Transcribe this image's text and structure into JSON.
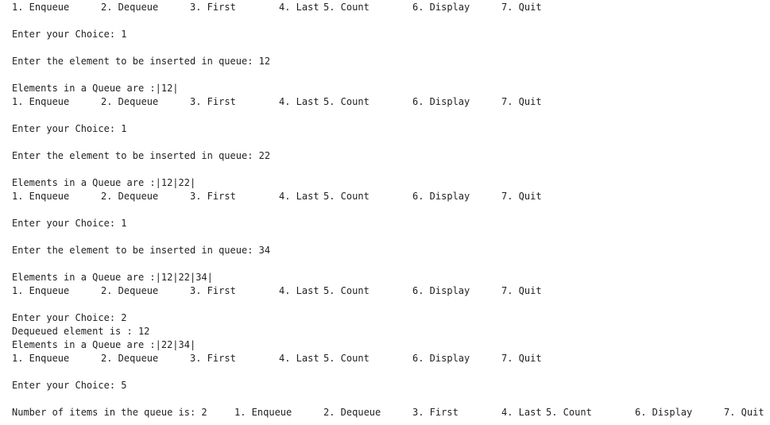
{
  "console": {
    "lines": [
      {
        "type": "menu",
        "row": 0,
        "prefix": "",
        "items": [
          "1. Enqueue",
          "2. Dequeue",
          "3. First",
          "4. Last",
          "5. Count",
          "6. Display",
          "7. Quit"
        ]
      },
      {
        "type": "text",
        "row": 2,
        "text": "Enter your Choice: 1"
      },
      {
        "type": "text",
        "row": 4,
        "text": "Enter the element to be inserted in queue: 12"
      },
      {
        "type": "text",
        "row": 6,
        "text": "Elements in a Queue are :|12|"
      },
      {
        "type": "menu",
        "row": 7,
        "prefix": "",
        "items": [
          "1. Enqueue",
          "2. Dequeue",
          "3. First",
          "4. Last",
          "5. Count",
          "6. Display",
          "7. Quit"
        ]
      },
      {
        "type": "text",
        "row": 9,
        "text": "Enter your Choice: 1"
      },
      {
        "type": "text",
        "row": 11,
        "text": "Enter the element to be inserted in queue: 22"
      },
      {
        "type": "text",
        "row": 13,
        "text": "Elements in a Queue are :|12|22|"
      },
      {
        "type": "menu",
        "row": 14,
        "prefix": "",
        "items": [
          "1. Enqueue",
          "2. Dequeue",
          "3. First",
          "4. Last",
          "5. Count",
          "6. Display",
          "7. Quit"
        ]
      },
      {
        "type": "text",
        "row": 16,
        "text": "Enter your Choice: 1"
      },
      {
        "type": "text",
        "row": 18,
        "text": "Enter the element to be inserted in queue: 34"
      },
      {
        "type": "text",
        "row": 20,
        "text": "Elements in a Queue are :|12|22|34|"
      },
      {
        "type": "menu",
        "row": 21,
        "prefix": "",
        "items": [
          "1. Enqueue",
          "2. Dequeue",
          "3. First",
          "4. Last",
          "5. Count",
          "6. Display",
          "7. Quit"
        ]
      },
      {
        "type": "text",
        "row": 23,
        "text": "Enter your Choice: 2"
      },
      {
        "type": "text",
        "row": 24,
        "text": "Dequeued element is : 12"
      },
      {
        "type": "text",
        "row": 25,
        "text": "Elements in a Queue are :|22|34|"
      },
      {
        "type": "menu",
        "row": 26,
        "prefix": "",
        "items": [
          "1. Enqueue",
          "2. Dequeue",
          "3. First",
          "4. Last",
          "5. Count",
          "6. Display",
          "7. Quit"
        ]
      },
      {
        "type": "text",
        "row": 28,
        "text": "Enter your Choice: 5"
      },
      {
        "type": "menu",
        "row": 30,
        "prefix": "Number of items in the queue is: 2",
        "items": [
          "1. Enqueue",
          "2. Dequeue",
          "3. First",
          "4. Last",
          "5. Count",
          "6. Display",
          "7. Quit"
        ]
      }
    ]
  }
}
